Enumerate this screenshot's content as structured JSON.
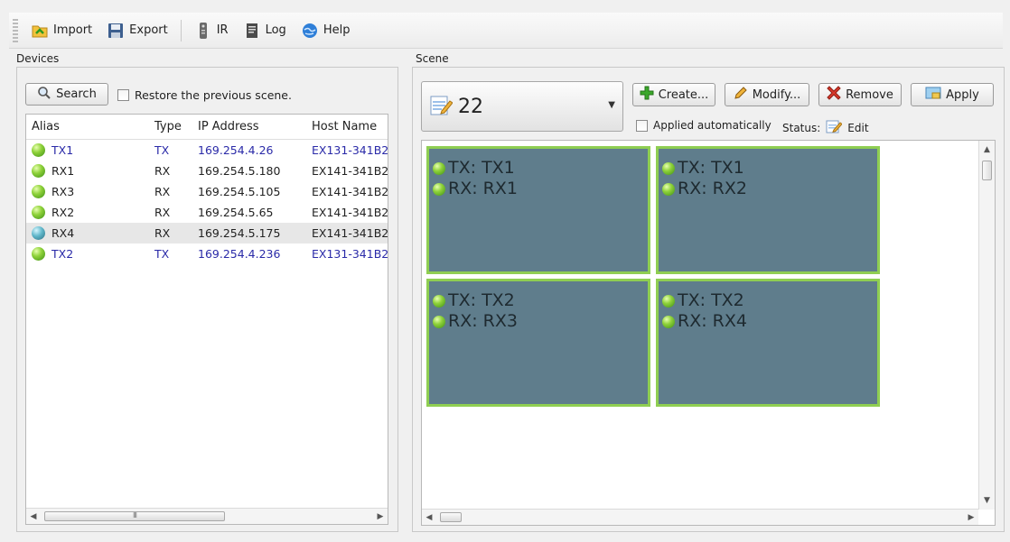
{
  "toolbar": {
    "import_label": "Import",
    "export_label": "Export",
    "ir_label": "IR",
    "log_label": "Log",
    "help_label": "Help"
  },
  "devices": {
    "group_title": "Devices",
    "search_label": "Search",
    "restore_label": "Restore the previous scene.",
    "columns": [
      "Alias",
      "Type",
      "IP Address",
      "Host Name"
    ],
    "rows": [
      {
        "alias": "TX1",
        "type": "TX",
        "ip": "169.254.4.26",
        "host": "EX131-341B2"
      },
      {
        "alias": "RX1",
        "type": "RX",
        "ip": "169.254.5.180",
        "host": "EX141-341B2"
      },
      {
        "alias": "RX3",
        "type": "RX",
        "ip": "169.254.5.105",
        "host": "EX141-341B2"
      },
      {
        "alias": "RX2",
        "type": "RX",
        "ip": "169.254.5.65",
        "host": "EX141-341B2"
      },
      {
        "alias": "RX4",
        "type": "RX",
        "ip": "169.254.5.175",
        "host": "EX141-341B2"
      },
      {
        "alias": "TX2",
        "type": "TX",
        "ip": "169.254.4.236",
        "host": "EX131-341B2"
      }
    ],
    "scroll_grip": "III"
  },
  "scene": {
    "group_title": "Scene",
    "selected_scene": "22",
    "create_label": "Create...",
    "modify_label": "Modify...",
    "remove_label": "Remove",
    "apply_label": "Apply",
    "applied_auto_label": "Applied automatically",
    "status_label": "Status:",
    "status_value": "Edit",
    "tiles": [
      {
        "tx": "TX: TX1",
        "rx": "RX: RX1"
      },
      {
        "tx": "TX: TX1",
        "rx": "RX: RX2"
      },
      {
        "tx": "TX: TX2",
        "rx": "RX: RX3"
      },
      {
        "tx": "TX: TX2",
        "rx": "RX: RX4"
      }
    ]
  },
  "colors": {
    "tile_bg": "#5f7d8c",
    "tile_border": "#8fce52",
    "tx_text": "#2a2aa8",
    "status_green": "#8fd23a"
  }
}
